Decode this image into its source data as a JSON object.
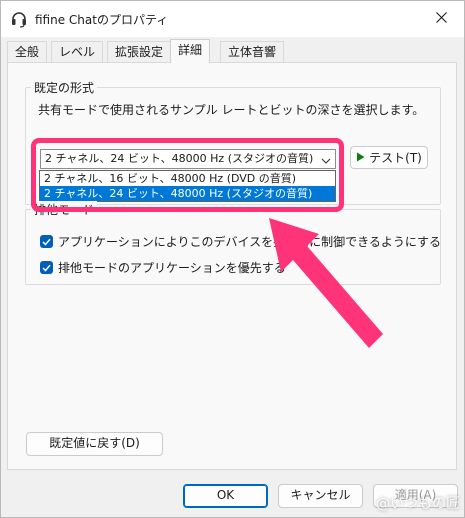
{
  "window": {
    "title": "fifine Chatのプロパティ",
    "close_icon": "close-icon"
  },
  "tabs": [
    {
      "label": "全般",
      "active": false
    },
    {
      "label": "レベル",
      "active": false
    },
    {
      "label": "拡張設定",
      "active": false
    },
    {
      "label": "詳細",
      "active": true
    },
    {
      "label": "立体音響",
      "active": false
    }
  ],
  "default_format": {
    "legend": "既定の形式",
    "description": "共有モードで使用されるサンプル レートとビットの深さを選択します。",
    "selected_value": "2 チャネル、24 ビット、48000 Hz (スタジオの音質)",
    "options": [
      {
        "label": "2 チャネル、16 ビット、48000 Hz (DVD の音質)",
        "selected": false
      },
      {
        "label": "2 チャネル、24 ビット、48000 Hz (スタジオの音質)",
        "selected": true
      }
    ],
    "test_button": "テスト(T)"
  },
  "exclusive_mode": {
    "legend": "排他モード",
    "allow_exclusive": {
      "label": "アプリケーションによりこのデバイスを排他的に制御できるようにする",
      "checked": true
    },
    "give_priority": {
      "label": "排他モードのアプリケーションを優先する",
      "checked": true
    }
  },
  "restore_defaults_button": "既定値に戻す(D)",
  "footer": {
    "ok": "OK",
    "cancel": "キャンセル",
    "apply": "適用(A)"
  },
  "watermark": "@いつもの匠",
  "colors": {
    "highlight": "#ff3377",
    "accent": "#0078d7",
    "checkbox": "#005fb8"
  }
}
